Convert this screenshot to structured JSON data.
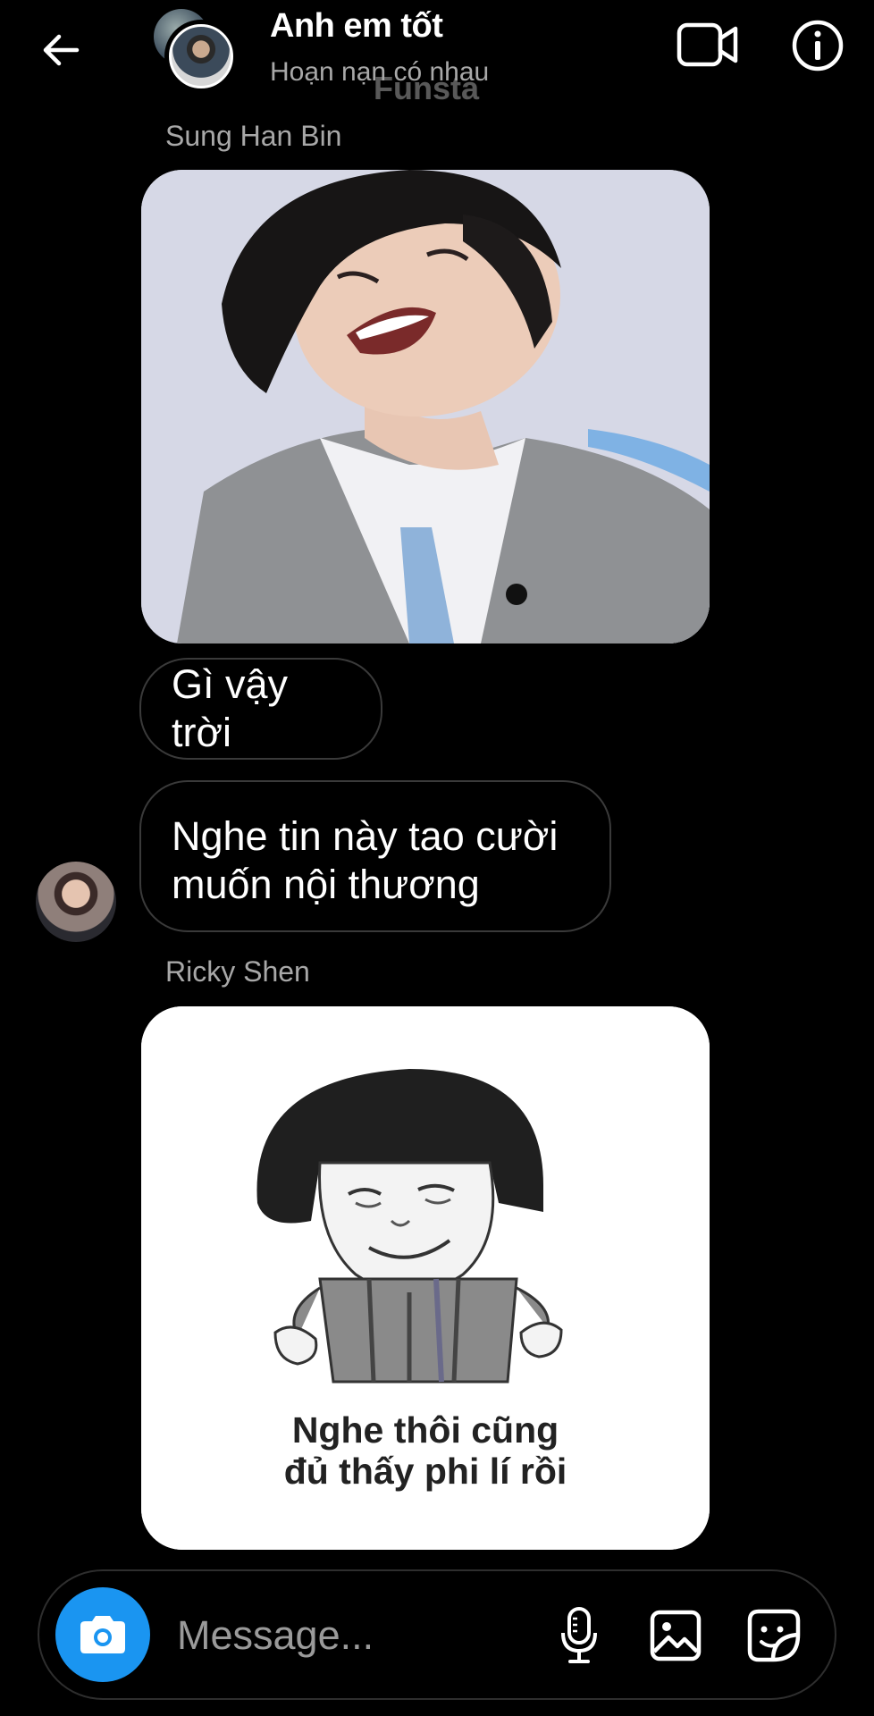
{
  "header": {
    "title": "Anh em tốt",
    "subtitle": "Hoạn nạn có nhau",
    "watermark": "Funsta",
    "icons": {
      "back": "arrow-left-icon",
      "video": "video-camera-icon",
      "info": "info-icon"
    }
  },
  "messages": [
    {
      "type": "sender_label",
      "text": "Sung Han Bin"
    },
    {
      "type": "image",
      "description_icon": "photo"
    },
    {
      "type": "text",
      "text": "Gì vậy trời"
    },
    {
      "type": "text",
      "text": "Nghe tin này tao cười muốn nội thương"
    },
    {
      "type": "sender_label",
      "text": "Ricky Shen"
    },
    {
      "type": "image",
      "caption_line1": "Nghe thôi cũng",
      "caption_line2": "đủ thấy phi lí rồi"
    }
  ],
  "composer": {
    "placeholder": "Message...",
    "camera_color": "#1a95f1",
    "icons": [
      "camera-icon",
      "microphone-icon",
      "gallery-icon",
      "sticker-icon"
    ]
  },
  "colors": {
    "background": "#000000",
    "secondary_text": "#a8a8a8",
    "bubble_border": "#3a3a3a",
    "accent": "#1a95f1"
  }
}
